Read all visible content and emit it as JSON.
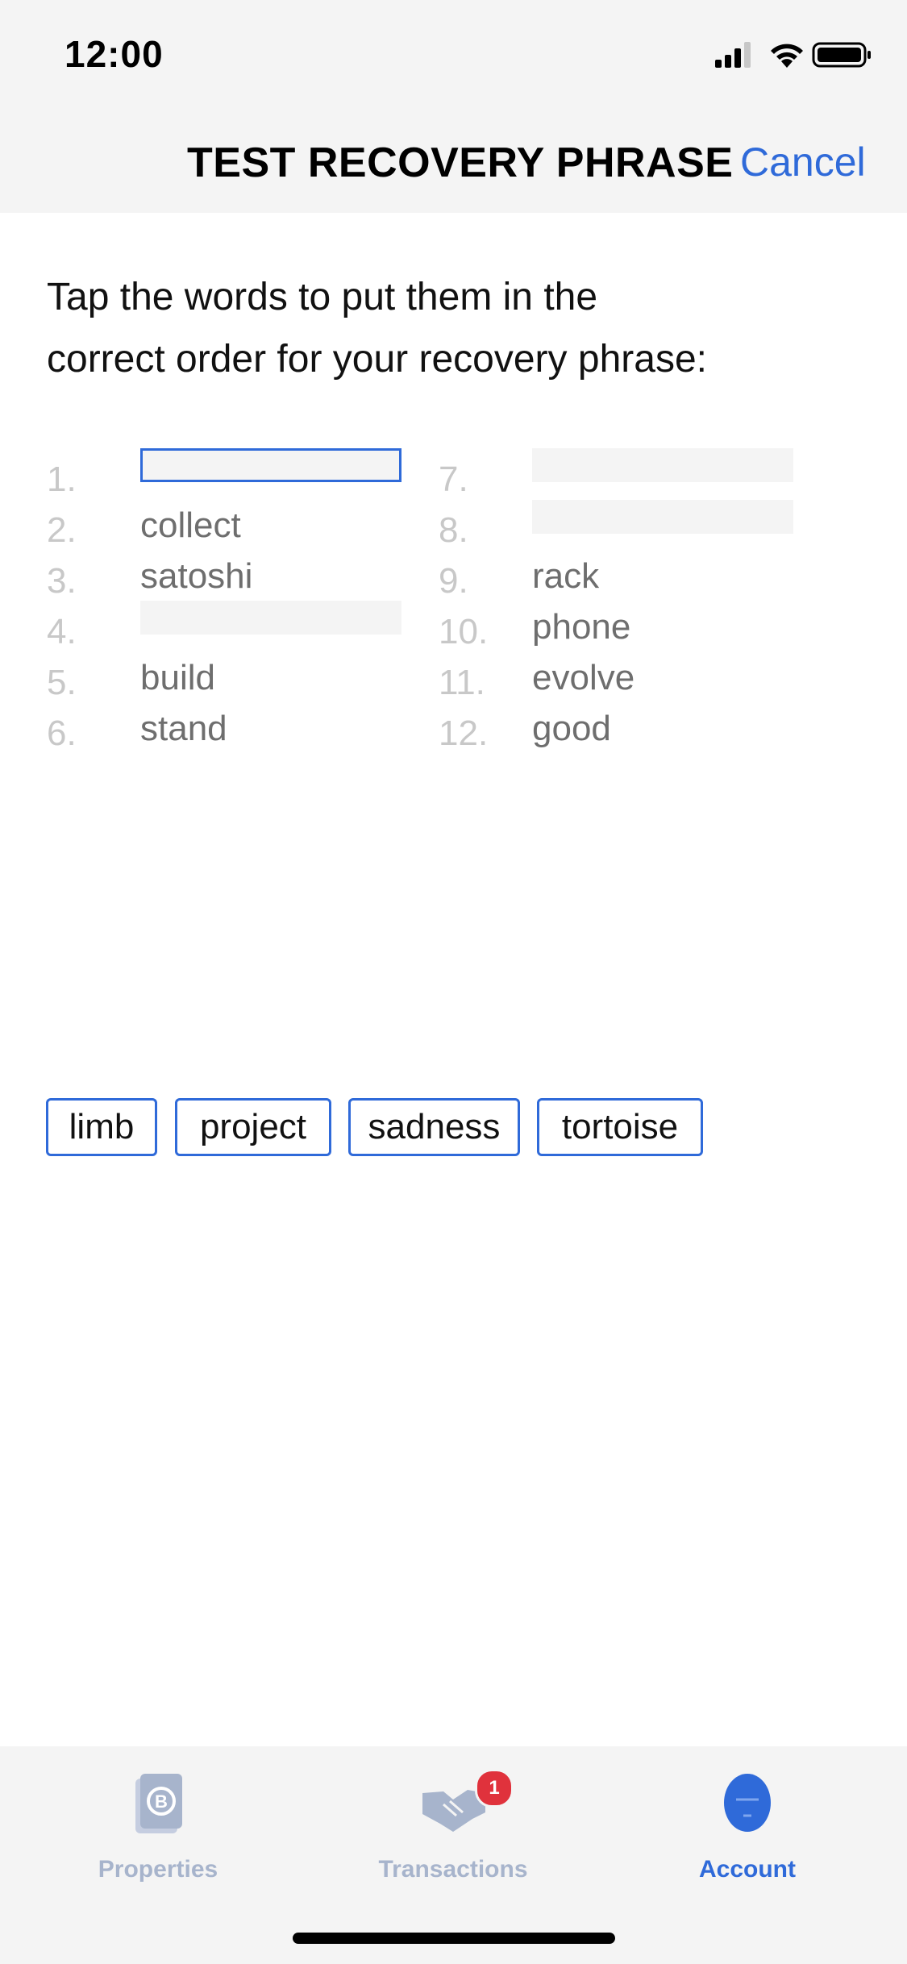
{
  "status": {
    "time": "12:00"
  },
  "header": {
    "title": "TEST RECOVERY PHRASE",
    "cancel_label": "Cancel"
  },
  "instructions": {
    "line1": "Tap the words to put them in the",
    "line2": "correct order for your recovery phrase:"
  },
  "phrase": [
    {
      "num": "1.",
      "word": ""
    },
    {
      "num": "2.",
      "word": "collect"
    },
    {
      "num": "3.",
      "word": "satoshi"
    },
    {
      "num": "4.",
      "word": ""
    },
    {
      "num": "5.",
      "word": "build"
    },
    {
      "num": "6.",
      "word": "stand"
    },
    {
      "num": "7.",
      "word": ""
    },
    {
      "num": "8.",
      "word": ""
    },
    {
      "num": "9.",
      "word": "rack"
    },
    {
      "num": "10.",
      "word": "phone"
    },
    {
      "num": "11.",
      "word": "evolve"
    },
    {
      "num": "12.",
      "word": "good"
    }
  ],
  "word_choices": [
    "limb",
    "project",
    "sadness",
    "tortoise"
  ],
  "tabs": [
    {
      "label": "Properties",
      "icon": "properties-icon",
      "active": false
    },
    {
      "label": "Transactions",
      "icon": "handshake-icon",
      "active": false,
      "badge": "1"
    },
    {
      "label": "Account",
      "icon": "account-icon",
      "active": true
    }
  ],
  "colors": {
    "accent": "#2f6ad9",
    "inactive_tab": "#a7b4cc",
    "badge": "#e0323c",
    "bar_bg": "#f4f4f4"
  }
}
